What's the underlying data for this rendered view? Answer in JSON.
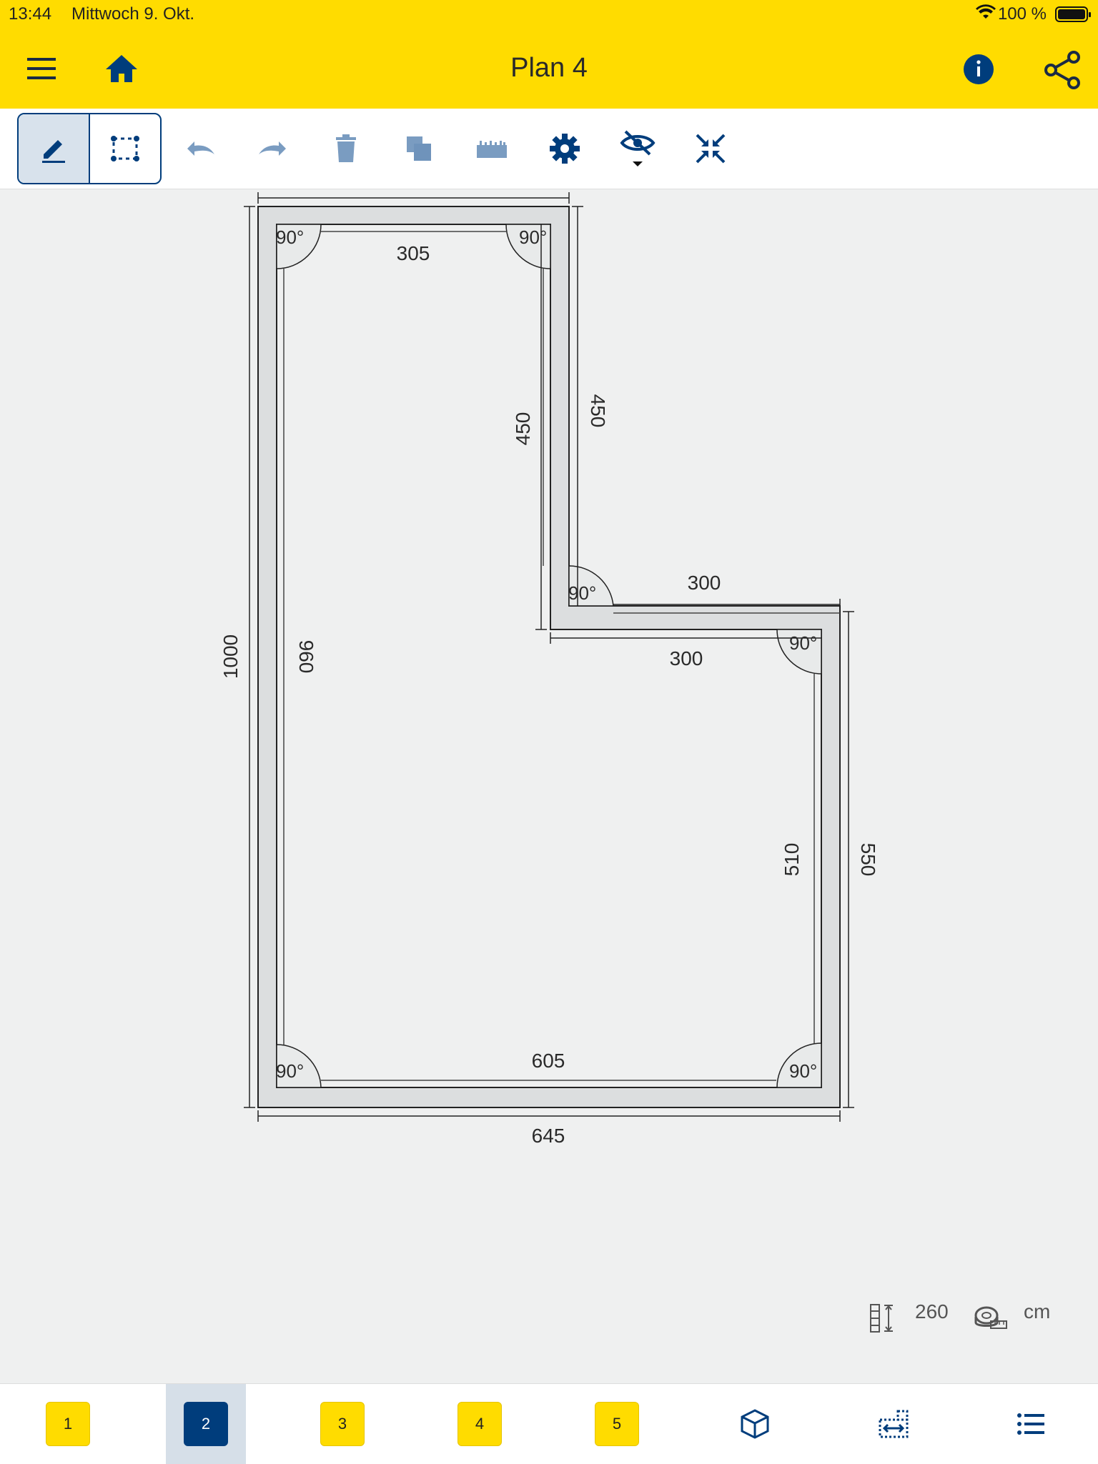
{
  "status": {
    "time": "13:44",
    "date": "Mittwoch 9. Okt.",
    "battery": "100 %"
  },
  "header": {
    "title": "Plan 4"
  },
  "toolbar": {
    "tools": [
      "undo-icon",
      "redo-icon",
      "trash-icon",
      "copy-icon",
      "ruler-icon",
      "gear-icon",
      "eye-off-icon",
      "compress-icon"
    ]
  },
  "plan": {
    "dims": {
      "top_inner": "305",
      "mid_inner_vertical": "450",
      "mid_outer_vertical": "450",
      "step_outer": "300",
      "step_inner": "300",
      "left_outer": "1000",
      "left_inner": "960",
      "right_inner": "510",
      "right_outer": "550",
      "bottom_inner": "605",
      "bottom_outer": "645"
    },
    "angle": "90°"
  },
  "info": {
    "height": "260",
    "unit": "cm"
  },
  "tabs": [
    "1",
    "2",
    "3",
    "4",
    "5"
  ],
  "active_tab": "2",
  "colors": {
    "accent": "#ffdc00",
    "primary": "#003d7c"
  }
}
